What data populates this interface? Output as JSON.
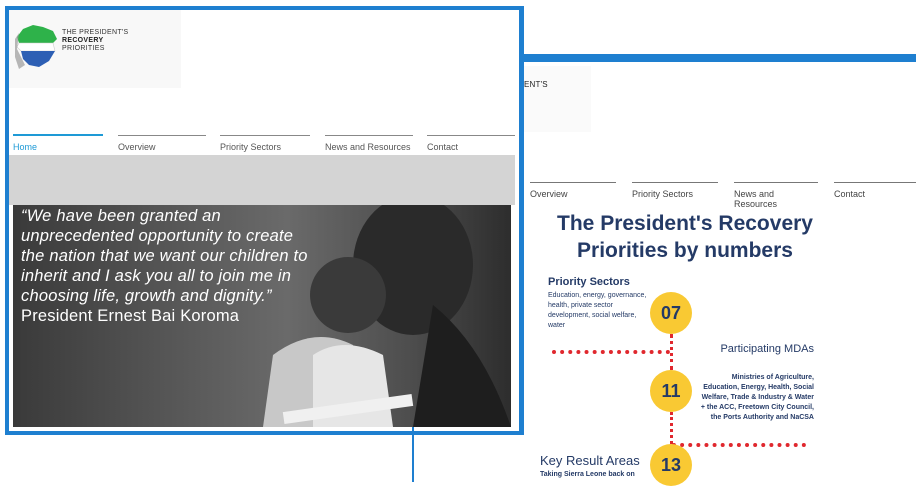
{
  "colors": {
    "accent": "#1e7fd0",
    "nav_active": "#1e9ad6",
    "navy": "#243a66",
    "yellow": "#f9c933",
    "red": "#e0282e"
  },
  "logo": {
    "line1": "THE PRESIDENT'S",
    "line2": "RECOVERY",
    "line3": "PRIORITIES",
    "icon": "sierra-leone-map-icon"
  },
  "nav": {
    "home": "Home",
    "overview": "Overview",
    "priority_sectors": "Priority Sectors",
    "news": "News and Resources",
    "contact": "Contact"
  },
  "hero": {
    "quote": "“We have been granted an unprecedented opportunity to create the nation that we want our children to inherit and I ask you all to join me in choosing life, growth and dignity.”",
    "author": " President Ernest Bai Koroma"
  },
  "background_page": {
    "logo_fragment": "DENT'S",
    "headline": "The President's Recovery Priorities by numbers",
    "sections": [
      {
        "title": "Priority Sectors",
        "number": "07",
        "text": "Education, energy, governance, health, private sector development, social welfare, water"
      },
      {
        "title": "Participating MDAs",
        "number": "11",
        "text": "Ministries of Agriculture, Education, Energy, Health, Social Welfare, Trade & Industry & Water + the ACC, Freetown City Council, the Ports Authority and NaCSA"
      },
      {
        "title": "Key Result Areas",
        "number": "13",
        "text": "Taking Sierra Leone back on"
      }
    ]
  }
}
